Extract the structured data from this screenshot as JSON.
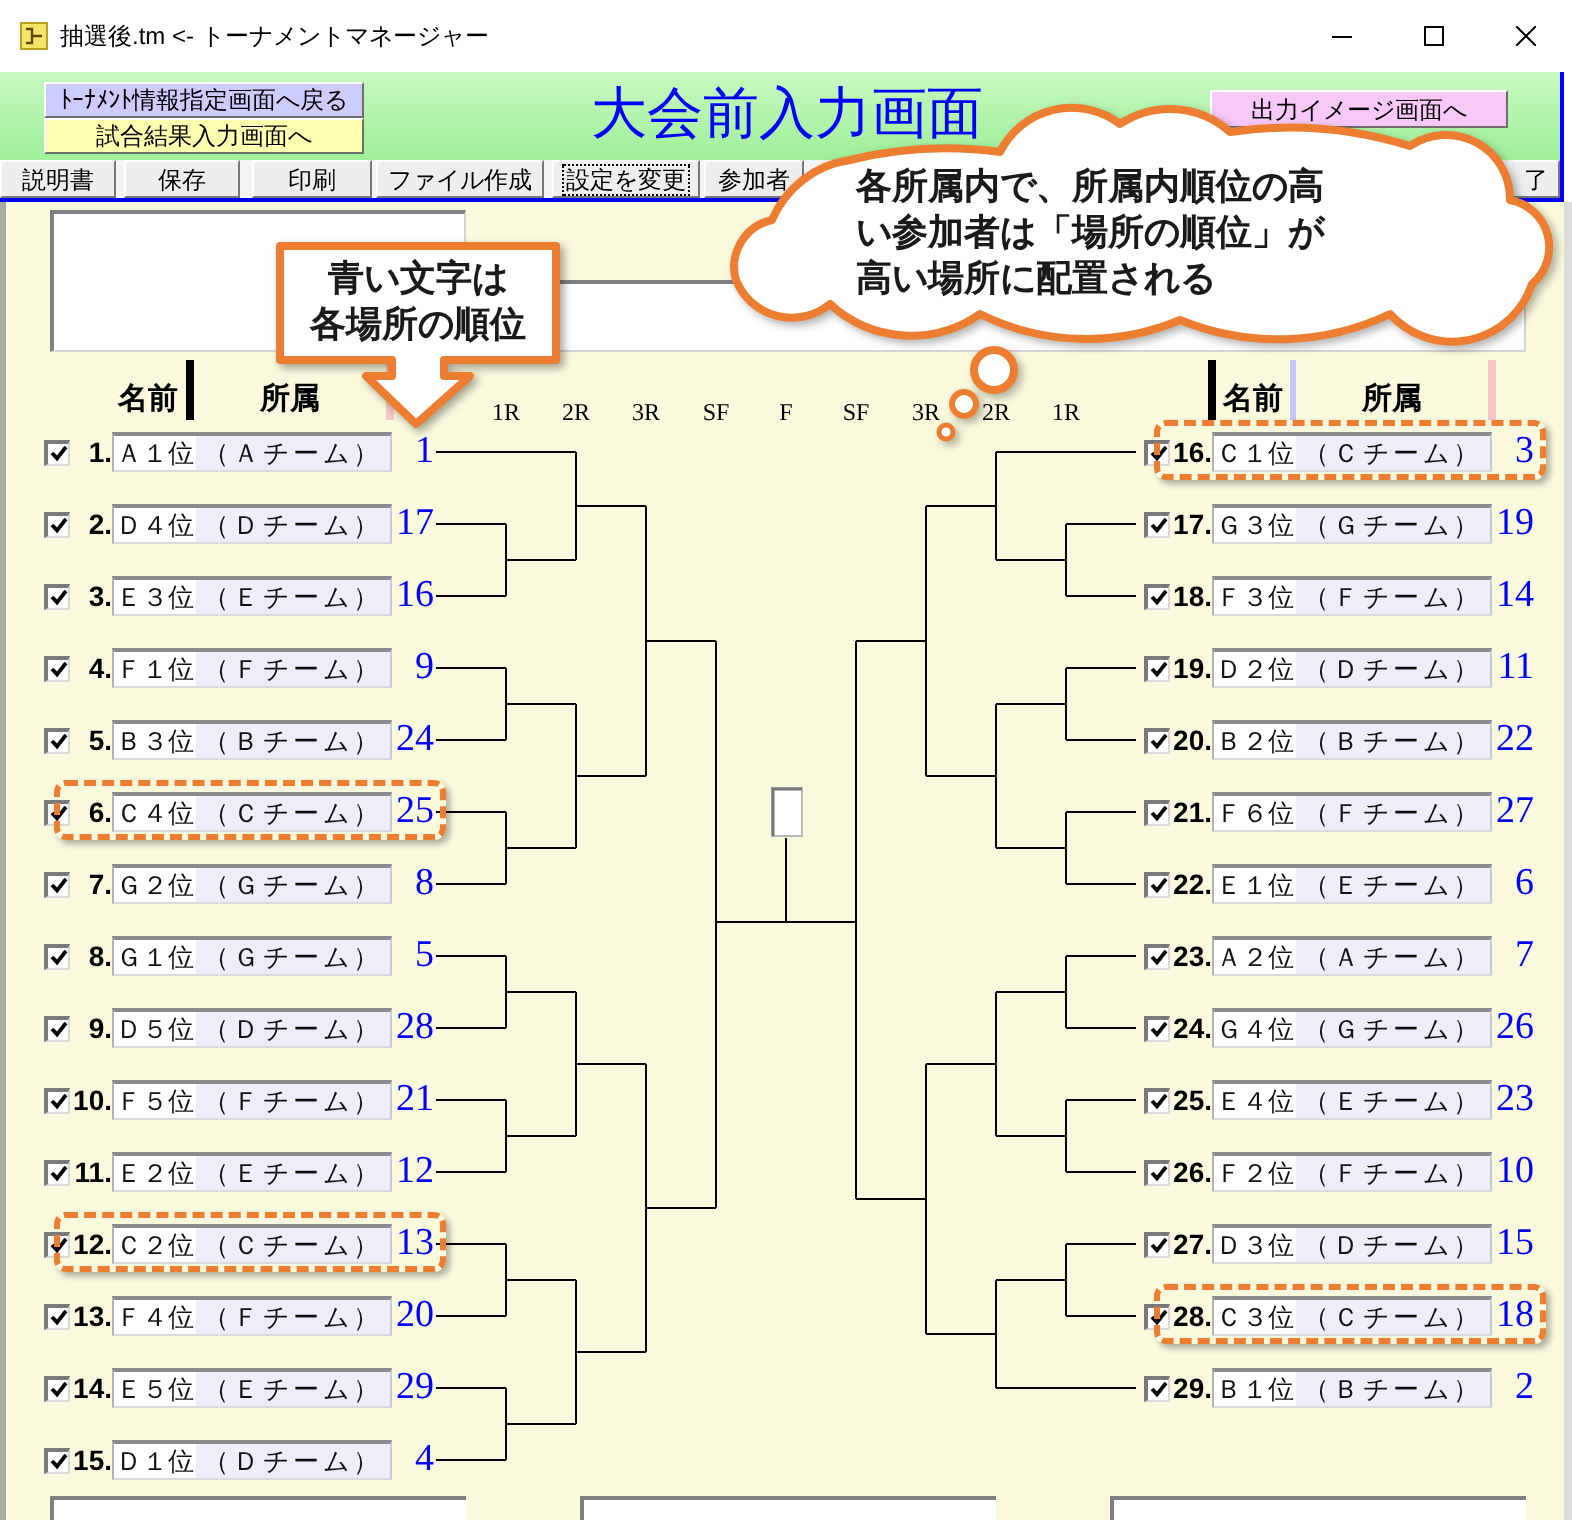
{
  "window": {
    "title": "抽選後.tm <- トーナメントマネージャー"
  },
  "header": {
    "title": "大会前入力画面",
    "nav_buttons": [
      {
        "label": "ﾄｰﾅﾒﾝﾄ情報指定画面へ戻る",
        "color": "#ccccff"
      },
      {
        "label": "試合結果入力画面へ",
        "color": "#ffffb0"
      }
    ],
    "output_button": {
      "label": "出力イメージ画面へ"
    }
  },
  "toolbar": {
    "buttons": [
      {
        "label": "説明書",
        "focused": false
      },
      {
        "label": "保存",
        "focused": false
      },
      {
        "label": "印刷",
        "focused": false
      },
      {
        "label": "ファイル作成",
        "focused": false
      },
      {
        "label": "設定を変更",
        "focused": true
      },
      {
        "label": "参加者",
        "focused": false
      }
    ],
    "end_buttons": [
      {
        "label": "了",
        "focused": false
      }
    ]
  },
  "rounds": [
    "1R",
    "2R",
    "3R",
    "SF",
    "F",
    "SF",
    "3R",
    "2R",
    "1R"
  ],
  "left_bracket": {
    "headers": {
      "name": "名前",
      "affiliation": "所属"
    },
    "entries": [
      {
        "checked": true,
        "number": "1.",
        "name": "Ａ１位",
        "affiliation": "（Ａチーム）",
        "rank": "1",
        "highlighted": false
      },
      {
        "checked": true,
        "number": "2.",
        "name": "Ｄ４位",
        "affiliation": "（Ｄチーム）",
        "rank": "17",
        "highlighted": false
      },
      {
        "checked": true,
        "number": "3.",
        "name": "Ｅ３位",
        "affiliation": "（Ｅチーム）",
        "rank": "16",
        "highlighted": false
      },
      {
        "checked": true,
        "number": "4.",
        "name": "Ｆ１位",
        "affiliation": "（Ｆチーム）",
        "rank": "9",
        "highlighted": false
      },
      {
        "checked": true,
        "number": "5.",
        "name": "Ｂ３位",
        "affiliation": "（Ｂチーム）",
        "rank": "24",
        "highlighted": false
      },
      {
        "checked": true,
        "number": "6.",
        "name": "Ｃ４位",
        "affiliation": "（Ｃチーム）",
        "rank": "25",
        "highlighted": true
      },
      {
        "checked": true,
        "number": "7.",
        "name": "Ｇ２位",
        "affiliation": "（Ｇチーム）",
        "rank": "8",
        "highlighted": false
      },
      {
        "checked": true,
        "number": "8.",
        "name": "Ｇ１位",
        "affiliation": "（Ｇチーム）",
        "rank": "5",
        "highlighted": false
      },
      {
        "checked": true,
        "number": "9.",
        "name": "Ｄ５位",
        "affiliation": "（Ｄチーム）",
        "rank": "28",
        "highlighted": false
      },
      {
        "checked": true,
        "number": "10.",
        "name": "Ｆ５位",
        "affiliation": "（Ｆチーム）",
        "rank": "21",
        "highlighted": false
      },
      {
        "checked": true,
        "number": "11.",
        "name": "Ｅ２位",
        "affiliation": "（Ｅチーム）",
        "rank": "12",
        "highlighted": false
      },
      {
        "checked": true,
        "number": "12.",
        "name": "Ｃ２位",
        "affiliation": "（Ｃチーム）",
        "rank": "13",
        "highlighted": true
      },
      {
        "checked": true,
        "number": "13.",
        "name": "Ｆ４位",
        "affiliation": "（Ｆチーム）",
        "rank": "20",
        "highlighted": false
      },
      {
        "checked": true,
        "number": "14.",
        "name": "Ｅ５位",
        "affiliation": "（Ｅチーム）",
        "rank": "29",
        "highlighted": false
      },
      {
        "checked": true,
        "number": "15.",
        "name": "Ｄ１位",
        "affiliation": "（Ｄチーム）",
        "rank": "4",
        "highlighted": false
      }
    ]
  },
  "right_bracket": {
    "headers": {
      "name": "名前",
      "affiliation": "所属"
    },
    "entries": [
      {
        "checked": true,
        "number": "16.",
        "name": "Ｃ１位",
        "affiliation": "（Ｃチーム）",
        "rank": "3",
        "highlighted": true
      },
      {
        "checked": true,
        "number": "17.",
        "name": "Ｇ３位",
        "affiliation": "（Ｇチーム）",
        "rank": "19",
        "highlighted": false
      },
      {
        "checked": true,
        "number": "18.",
        "name": "Ｆ３位",
        "affiliation": "（Ｆチーム）",
        "rank": "14",
        "highlighted": false
      },
      {
        "checked": true,
        "number": "19.",
        "name": "Ｄ２位",
        "affiliation": "（Ｄチーム）",
        "rank": "11",
        "highlighted": false
      },
      {
        "checked": true,
        "number": "20.",
        "name": "Ｂ２位",
        "affiliation": "（Ｂチーム）",
        "rank": "22",
        "highlighted": false
      },
      {
        "checked": true,
        "number": "21.",
        "name": "Ｆ６位",
        "affiliation": "（Ｆチーム）",
        "rank": "27",
        "highlighted": false
      },
      {
        "checked": true,
        "number": "22.",
        "name": "Ｅ１位",
        "affiliation": "（Ｅチーム）",
        "rank": "6",
        "highlighted": false
      },
      {
        "checked": true,
        "number": "23.",
        "name": "Ａ２位",
        "affiliation": "（Ａチーム）",
        "rank": "7",
        "highlighted": false
      },
      {
        "checked": true,
        "number": "24.",
        "name": "Ｇ４位",
        "affiliation": "（Ｇチーム）",
        "rank": "26",
        "highlighted": false
      },
      {
        "checked": true,
        "number": "25.",
        "name": "Ｅ４位",
        "affiliation": "（Ｅチーム）",
        "rank": "23",
        "highlighted": false
      },
      {
        "checked": true,
        "number": "26.",
        "name": "Ｆ２位",
        "affiliation": "（Ｆチーム）",
        "rank": "10",
        "highlighted": false
      },
      {
        "checked": true,
        "number": "27.",
        "name": "Ｄ３位",
        "affiliation": "（Ｄチーム）",
        "rank": "15",
        "highlighted": false
      },
      {
        "checked": true,
        "number": "28.",
        "name": "Ｃ３位",
        "affiliation": "（Ｃチーム）",
        "rank": "18",
        "highlighted": true
      },
      {
        "checked": true,
        "number": "29.",
        "name": "Ｂ１位",
        "affiliation": "（Ｂチーム）",
        "rank": "2",
        "highlighted": false
      }
    ]
  },
  "callouts": {
    "arrow_lines": [
      "青い文字は",
      "各場所の順位"
    ],
    "cloud": "各所属内で、所属内順位の高い参加者は「場所の順位」が高い場所に配置される"
  }
}
